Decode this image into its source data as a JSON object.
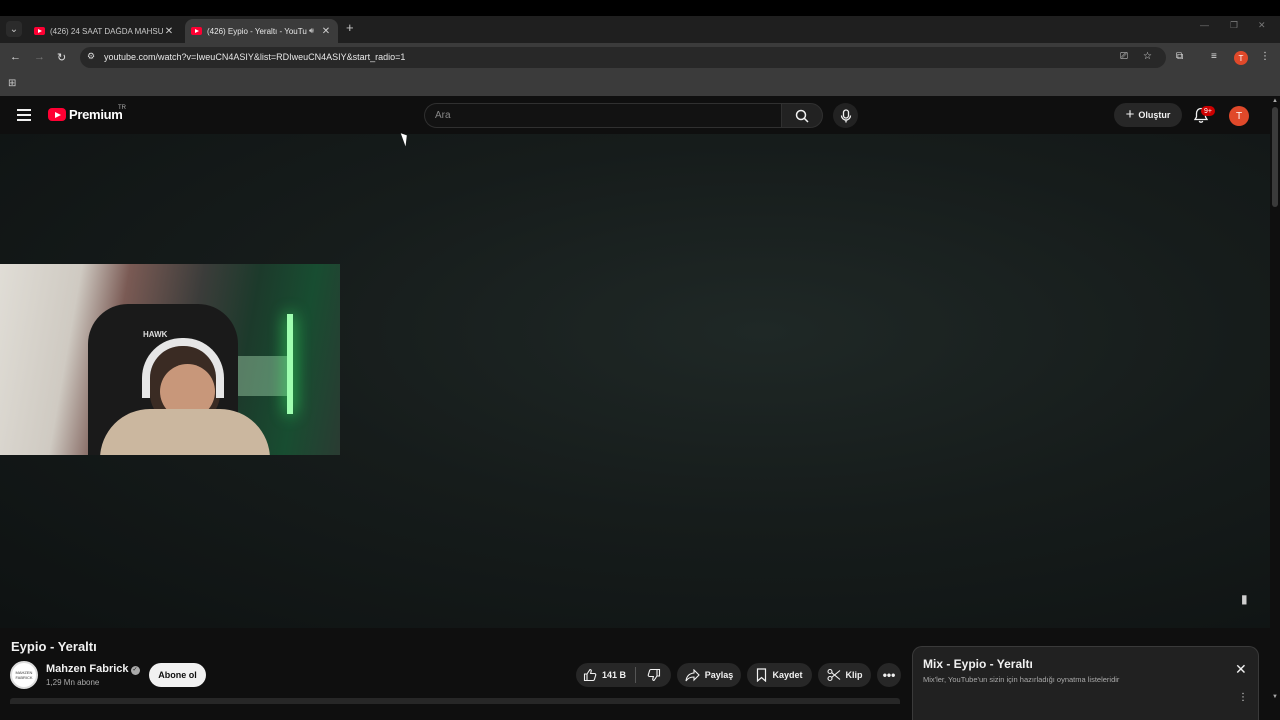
{
  "browser": {
    "tabs": [
      {
        "title": "(426) 24 SAAT DAĞDA MAHSUR",
        "active": false
      },
      {
        "title": "(426) Eypio - Yeraltı - YouTu",
        "active": true
      }
    ],
    "url": "youtube.com/watch?v=IweuCN4ASIY&list=RDIweuCN4ASIY&start_radio=1",
    "profile_initial": "T"
  },
  "youtube": {
    "logo_text": "Premium",
    "country_code": "TR",
    "search_placeholder": "Ara",
    "create_label": "Oluştur",
    "notifications_badge": "9+",
    "avatar_initial": "T"
  },
  "video": {
    "title": "Eypio - Yeraltı",
    "channel_name": "Mahzen Fabrick",
    "channel_avatar_text": "MAHZEN FABRICK",
    "subscribers": "1,29 Mn abone",
    "subscribe_label": "Abone ol",
    "likes": "141 B",
    "share_label": "Paylaş",
    "save_label": "Kaydet",
    "clip_label": "Klip",
    "webcam_brand": "HAWK"
  },
  "mix": {
    "title": "Mix - Eypio - Yeraltı",
    "subtitle": "Mix'ler, YouTube'un sizin için hazırladığı oynatma listeleridir"
  }
}
